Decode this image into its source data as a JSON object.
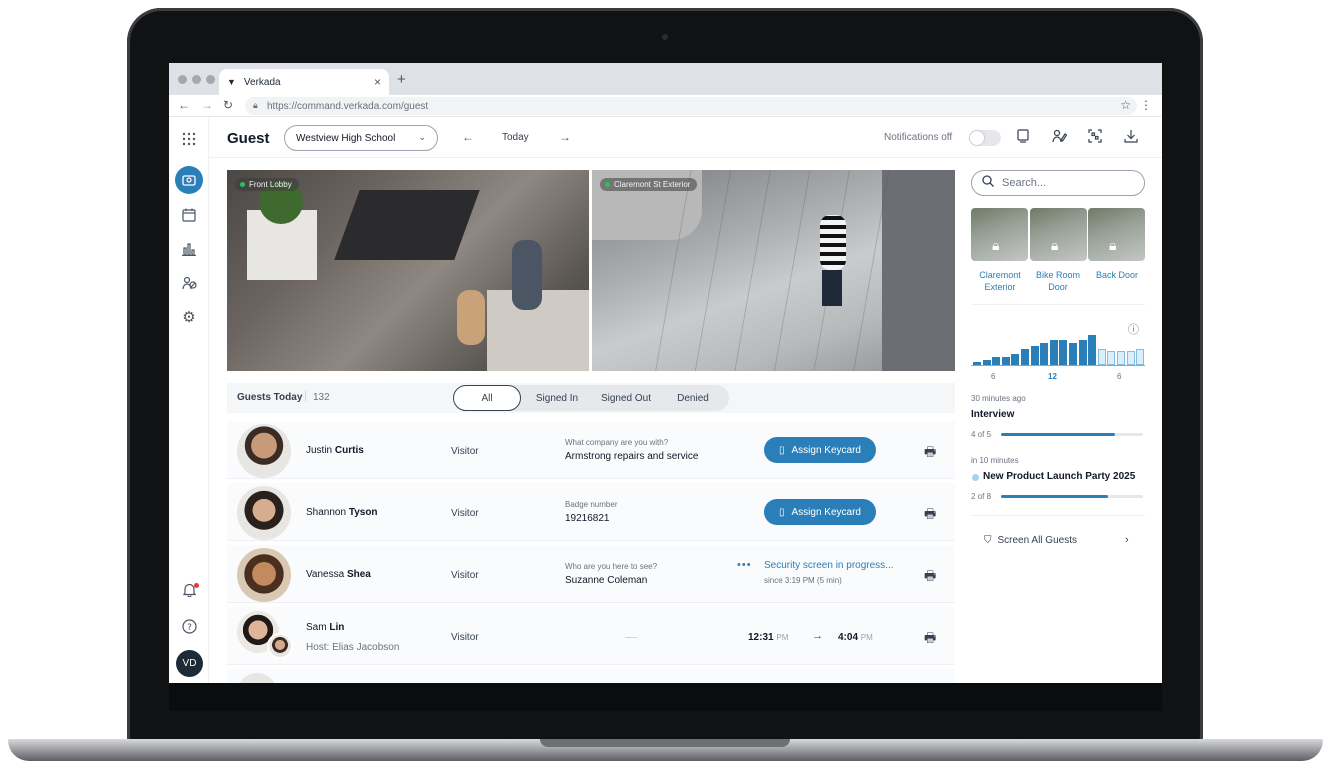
{
  "browser": {
    "tab_title": "Verkada",
    "tab_close": "×",
    "new_tab": "+",
    "url": "https://command.verkada.com/guest"
  },
  "colors": {
    "accent": "#2b7fb9",
    "sidebar_active": "#2b7fb9",
    "status_green": "#22c55e"
  },
  "topbar": {
    "title": "Guest",
    "site": "Westview High School",
    "date": "Today",
    "notifications_label": "Notifications off",
    "notifications_on": false
  },
  "sidebar": {
    "icons": [
      "apps-grid-icon",
      "guest-icon",
      "calendar-icon",
      "analytics-icon",
      "people-icon",
      "settings-icon",
      "bell-icon",
      "help-icon"
    ],
    "avatar_initials": "VD"
  },
  "cameras": [
    {
      "label": "Front Lobby"
    },
    {
      "label": "Claremont St Exterior"
    }
  ],
  "guests": {
    "header": "Guests Today",
    "count": "132",
    "filters": [
      "All",
      "Signed In",
      "Signed Out",
      "Denied"
    ],
    "active_filter": "All",
    "rows": [
      {
        "first": "Justin",
        "last": "Curtis",
        "type": "Visitor",
        "question": "What company are you with?",
        "answer": "Armstrong repairs and service",
        "action": "Assign Keycard"
      },
      {
        "first": "Shannon",
        "last": "Tyson",
        "type": "Visitor",
        "question": "Badge number",
        "answer": "19216821",
        "action": "Assign Keycard"
      },
      {
        "first": "Vanessa",
        "last": "Shea",
        "type": "Visitor",
        "question": "Who are you here to see?",
        "answer": "Suzanne Coleman",
        "status": "Security screen in progress...",
        "since": "since 3:19 PM (5 min)"
      },
      {
        "first": "Sam",
        "last": "Lin",
        "host": "Host: Elias Jacobson",
        "type": "Visitor",
        "time_in": "12:31",
        "time_in_ampm": "PM",
        "time_out": "4:04",
        "time_out_ampm": "PM"
      }
    ]
  },
  "right_panel": {
    "search_placeholder": "Search...",
    "doors": [
      {
        "label": "Claremont Exterior",
        "locked": true
      },
      {
        "label": "Bike Room Door",
        "locked": true
      },
      {
        "label": "Back Door",
        "locked": true
      }
    ],
    "histogram": {
      "ticks": [
        "6",
        "12",
        "6"
      ],
      "highlight_tick": "12",
      "values": [
        1,
        2,
        3,
        3,
        4,
        6,
        7,
        8,
        9,
        9,
        8,
        9,
        11,
        6,
        5,
        5,
        5,
        6
      ],
      "future_from_index": 13,
      "max": 11
    },
    "events": [
      {
        "when": "30 minutes ago",
        "title": "Interview",
        "count": "4 of 5",
        "progress": 0.8
      },
      {
        "when": "in 10 minutes",
        "title": "New Product Launch Party 2025",
        "count": "2 of 8",
        "progress": 0.75
      }
    ],
    "screen_all": "Screen All Guests"
  }
}
